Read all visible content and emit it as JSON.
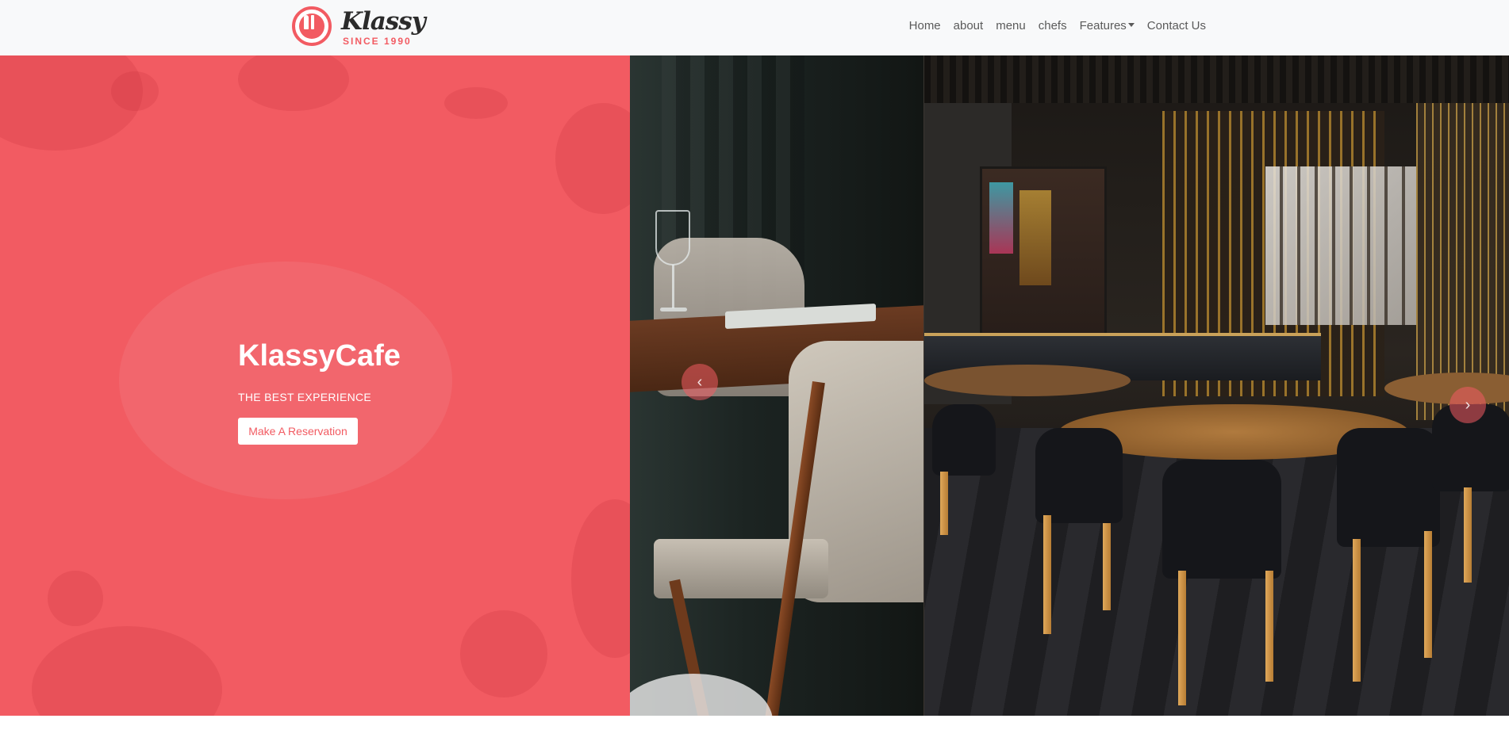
{
  "navbar": {
    "logo": {
      "name": "Klassy",
      "since": "SINCE 1990"
    },
    "links": [
      {
        "label": "Home"
      },
      {
        "label": "about"
      },
      {
        "label": "menu"
      },
      {
        "label": "chefs"
      },
      {
        "label": "Features"
      },
      {
        "label": "Contact Us"
      }
    ]
  },
  "hero": {
    "title": "KlassyCafe",
    "subtitle": "THE BEST EXPERIENCE",
    "cta_label": "Make A Reservation"
  },
  "carousel": {
    "prev_icon": "chevron-left-icon",
    "next_icon": "chevron-right-icon",
    "prev_symbol": "‹",
    "next_symbol": "›"
  },
  "colors": {
    "brand": "#f25b62",
    "navbar_bg": "#f8f9fa",
    "nav_text": "#5a5a5a"
  }
}
